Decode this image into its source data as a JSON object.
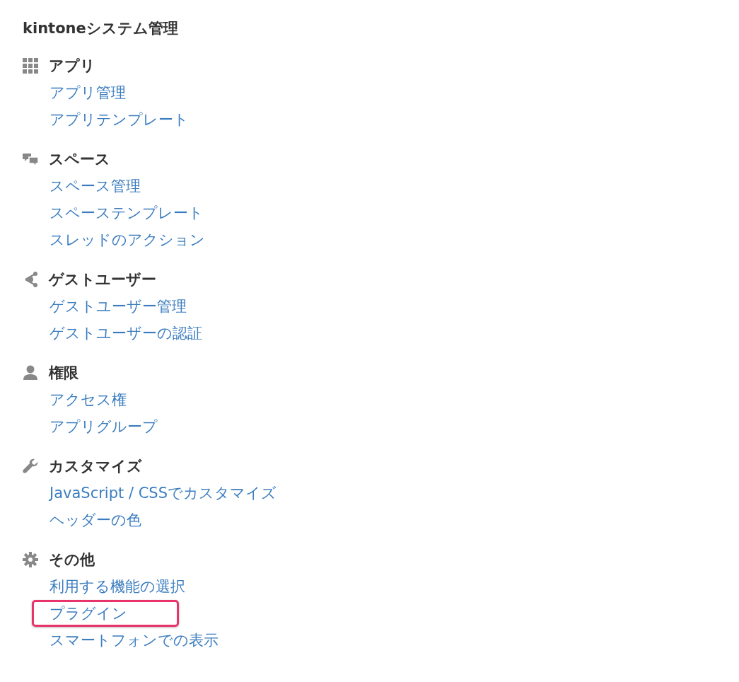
{
  "title": "kintoneシステム管理",
  "sections": [
    {
      "heading": "アプリ",
      "links": [
        {
          "label": "アプリ管理",
          "highlighted": false
        },
        {
          "label": "アプリテンプレート",
          "highlighted": false
        }
      ]
    },
    {
      "heading": "スペース",
      "links": [
        {
          "label": "スペース管理",
          "highlighted": false
        },
        {
          "label": "スペーステンプレート",
          "highlighted": false
        },
        {
          "label": "スレッドのアクション",
          "highlighted": false
        }
      ]
    },
    {
      "heading": "ゲストユーザー",
      "links": [
        {
          "label": "ゲストユーザー管理",
          "highlighted": false
        },
        {
          "label": "ゲストユーザーの認証",
          "highlighted": false
        }
      ]
    },
    {
      "heading": "権限",
      "links": [
        {
          "label": "アクセス権",
          "highlighted": false
        },
        {
          "label": "アプリグループ",
          "highlighted": false
        }
      ]
    },
    {
      "heading": "カスタマイズ",
      "links": [
        {
          "label": "JavaScript / CSSでカスタマイズ",
          "highlighted": false
        },
        {
          "label": "ヘッダーの色",
          "highlighted": false
        }
      ]
    },
    {
      "heading": "その他",
      "links": [
        {
          "label": "利用する機能の選択",
          "highlighted": false
        },
        {
          "label": "プラグイン",
          "highlighted": true
        },
        {
          "label": "スマートフォンでの表示",
          "highlighted": false
        }
      ]
    }
  ]
}
